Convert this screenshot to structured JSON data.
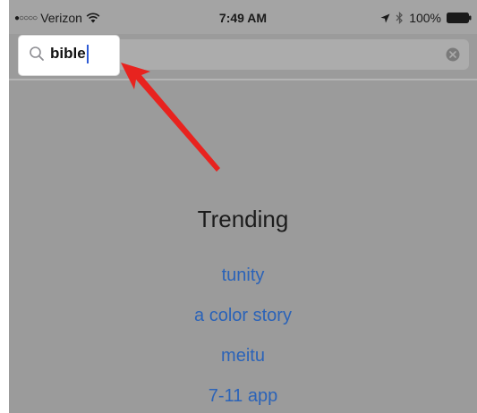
{
  "status_bar": {
    "signal": "●○○○○",
    "carrier": "Verizon",
    "time": "7:49 AM",
    "battery": "100%",
    "icons": [
      "wifi-icon",
      "location-icon",
      "bluetooth-icon",
      "battery-icon"
    ]
  },
  "search": {
    "query": "bible",
    "icon": "search-icon",
    "clear_icon": "clear-icon"
  },
  "trending": {
    "title": "Trending",
    "items": [
      "tunity",
      "a color story",
      "meitu",
      "7-11 app"
    ]
  },
  "annotation": {
    "icon": "red-arrow-icon",
    "color": "#e8231f"
  },
  "colors": {
    "link": "#2b63b8",
    "background": "#9b9b9b",
    "caret": "#2f5bd5"
  }
}
